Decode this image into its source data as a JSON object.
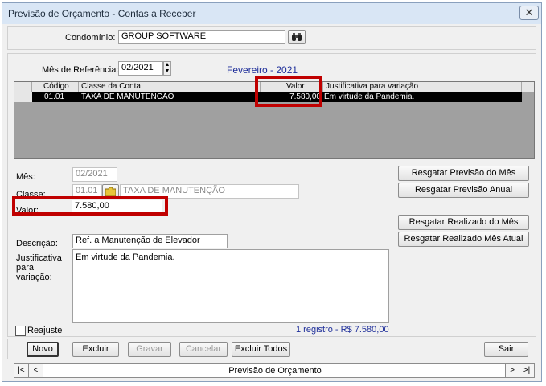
{
  "window": {
    "title": "Previsão de Orçamento - Contas a Receber",
    "close": "✕"
  },
  "condominio": {
    "label": "Condomínio:",
    "value": "GROUP SOFTWARE"
  },
  "referencia": {
    "label": "Mês de Referência:",
    "value": "02/2021",
    "month_name": "Fevereiro - 2021"
  },
  "grid": {
    "headers": {
      "codigo": "Código",
      "classe": "Classe da Conta",
      "valor": "Valor",
      "justificativa": "Justificativa para variação"
    },
    "rows": [
      {
        "codigo": "01.01",
        "classe": "TAXA DE MANUTENCÃO",
        "valor": "7.580,00",
        "justificativa": "Em virtude da Pandemia."
      }
    ]
  },
  "form": {
    "mes_label": "Mês:",
    "mes_value": "02/2021",
    "classe_label": "Classe:",
    "classe_code": "01.01",
    "classe_name": "TAXA DE MANUTENÇÃO",
    "valor_label": "Valor:",
    "valor_value": "7.580,00",
    "descricao_label": "Descrição:",
    "descricao_value": "Ref. a Manutenção de Elevador",
    "justificativa_label_1": "Justificativa",
    "justificativa_label_2": "para",
    "justificativa_label_3": "variação:",
    "justificativa_value": "Em virtude da Pandemia."
  },
  "side_buttons": {
    "previsao_mes": "Resgatar Previsão do Mês",
    "previsao_anual": "Resgatar Previsão Anual",
    "realizado_mes": "Resgatar Realizado do Mês",
    "realizado_mes_atual": "Resgatar Realizado Mês Atual"
  },
  "reajuste_label": "Reajuste",
  "status": "1 registro - R$ 7.580,00",
  "toolbar": {
    "novo": "Novo",
    "excluir": "Excluir",
    "gravar": "Gravar",
    "cancelar": "Cancelar",
    "excluir_todos": "Excluir Todos",
    "sair": "Sair"
  },
  "navigator": {
    "first": "|<",
    "prev": "<",
    "caption": "Previsão de Orçamento",
    "next": ">",
    "last": ">|"
  },
  "colors": {
    "highlight_red": "#c00000",
    "month_blue": "#1f2f9a",
    "status_blue": "#1f2f9a"
  }
}
